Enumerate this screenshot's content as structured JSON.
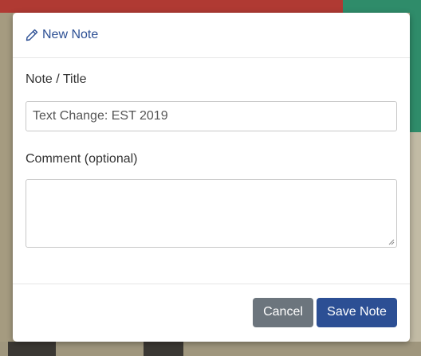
{
  "modal": {
    "title": "New Note",
    "title_icon": "pencil-icon",
    "note_label": "Note / Title",
    "note_value": "Text Change: EST 2019",
    "comment_label": "Comment (optional)",
    "comment_value": "",
    "cancel_label": "Cancel",
    "save_label": "Save Note"
  },
  "colors": {
    "accent": "#2c4f94",
    "cancel": "#6c757d",
    "backdrop": "#b5ab8f"
  }
}
